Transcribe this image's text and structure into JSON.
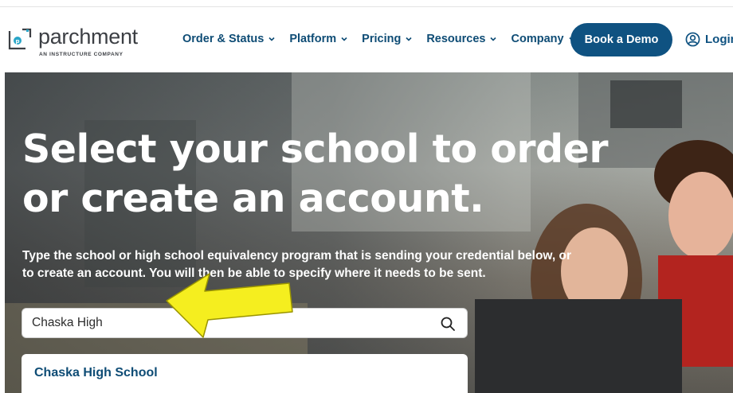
{
  "header": {
    "logo": {
      "name": "parchment",
      "tagline": "AN INSTRUCTURE COMPANY"
    },
    "nav": [
      {
        "label": "Order & Status"
      },
      {
        "label": "Platform"
      },
      {
        "label": "Pricing"
      },
      {
        "label": "Resources"
      },
      {
        "label": "Company"
      }
    ],
    "demo_button": "Book a Demo",
    "login": "Login"
  },
  "hero": {
    "title": "Select your school to order or create an account.",
    "description": "Type the school or high school equivalency program that is sending your credential below, or to create an account. You will then be able to specify where it needs to be sent.",
    "search": {
      "value": "Chaska High"
    },
    "results": [
      {
        "label": "Chaska High School"
      }
    ]
  },
  "colors": {
    "brand_navy": "#0f5281",
    "nav_text": "#0e4c75",
    "annotation_arrow": "#f5ee1f",
    "logo_accent": "#2aa6c8"
  },
  "icons": {
    "nav_chevron": "chevron-down-icon",
    "login": "user-circle-icon",
    "search": "search-icon",
    "annotation": "arrow-annotation-icon"
  }
}
